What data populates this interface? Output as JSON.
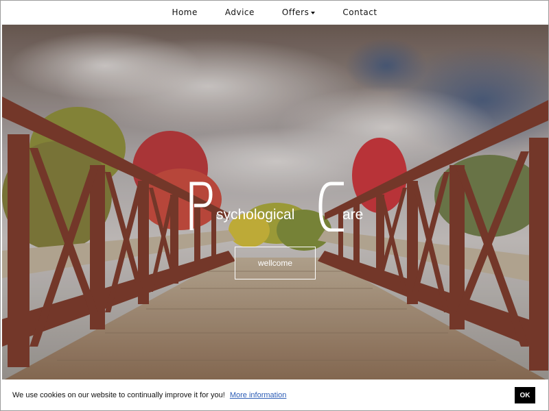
{
  "nav": {
    "items": [
      {
        "label": "Home"
      },
      {
        "label": "Advice"
      },
      {
        "label": "Offers"
      },
      {
        "label": "Contact"
      }
    ]
  },
  "hero": {
    "logo_letter_p": "P",
    "logo_letter_c": "C",
    "logo_word_1": "sychological",
    "logo_word_2": "are",
    "welcome_label": "wellcome"
  },
  "cookie": {
    "text": "We use cookies on our website to continually improve it for you!",
    "link_label": "More information",
    "ok_label": "OK"
  },
  "colors": {
    "bridge_rail": "#7a3a2c",
    "deck": "#a08a72",
    "sky": "#8a8f99",
    "foliage_red": "#c23a3a",
    "foliage_yellow": "#a7a23a"
  }
}
